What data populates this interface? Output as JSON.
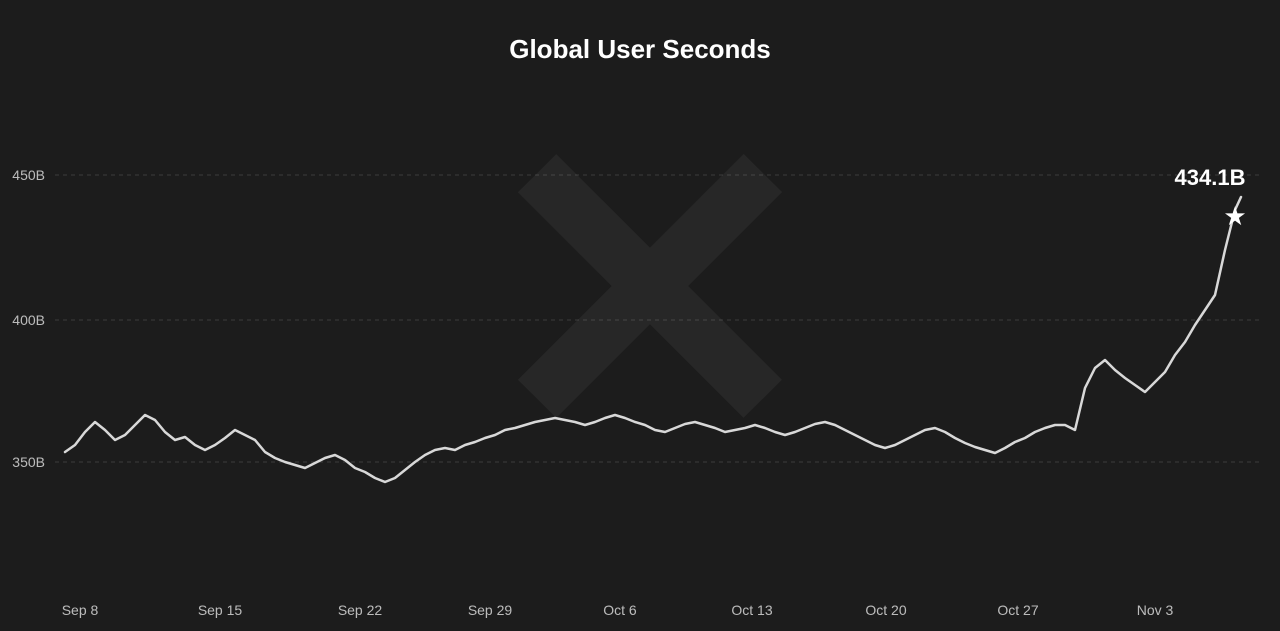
{
  "chart": {
    "title": "Global User Seconds",
    "background_color": "#1c1c1c",
    "line_color": "#d0d0d0",
    "grid_color": "rgba(255,255,255,0.12)",
    "y_axis": {
      "labels": [
        "350B",
        "400B",
        "450B"
      ],
      "values": [
        350,
        400,
        450
      ]
    },
    "x_axis": {
      "labels": [
        "Sep 8",
        "Sep 15",
        "Sep 22",
        "Sep 29",
        "Oct 6",
        "Oct 13",
        "Oct 20",
        "Oct 27",
        "Nov 3"
      ]
    },
    "peak_value": "434.1B",
    "x_logo": "𝕏"
  }
}
